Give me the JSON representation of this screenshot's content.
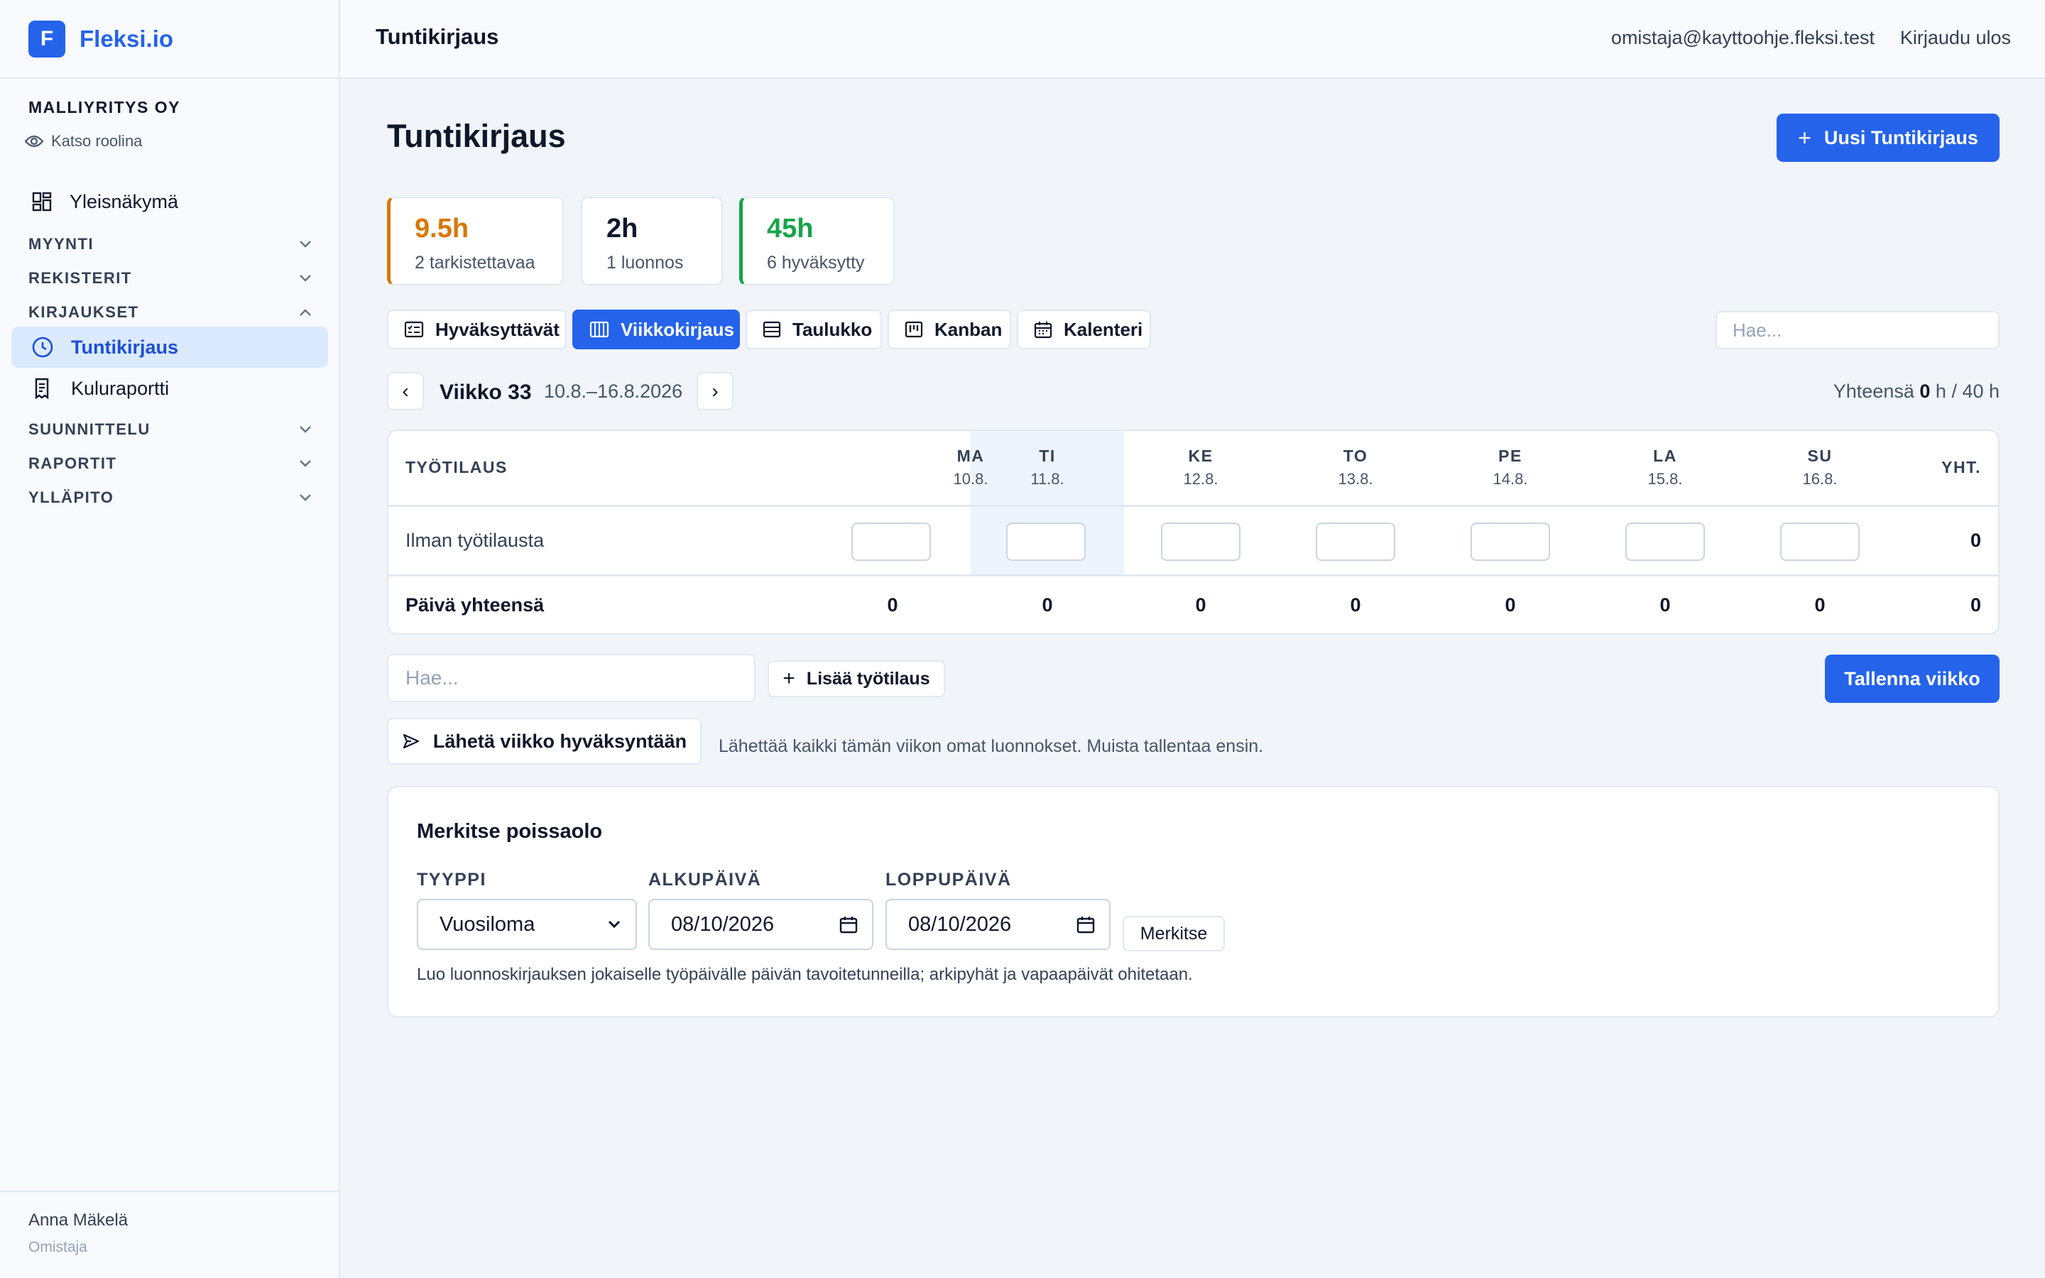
{
  "brand": {
    "logo_letter": "F",
    "name": "Fleksi.io"
  },
  "sidebar": {
    "company": "MALLIYRITYS OY",
    "view_as_role": "Katso roolina",
    "overview": "Yleisnäkymä",
    "sections": {
      "sales": "MYYNTI",
      "registers": "REKISTERIT",
      "entries": "KIRJAUKSET",
      "planning": "SUUNNITTELU",
      "reports": "RAPORTIT",
      "admin": "YLLÄPITO"
    },
    "entries_items": [
      {
        "label": "Tuntikirjaus",
        "icon": "clock-icon",
        "active": true
      },
      {
        "label": "Kuluraportti",
        "icon": "receipt-icon",
        "active": false
      }
    ],
    "user": {
      "name": "Anna Mäkelä",
      "role": "Omistaja"
    }
  },
  "topbar": {
    "title": "Tuntikirjaus",
    "email": "omistaja@kayttoohje.fleksi.test",
    "logout": "Kirjaudu ulos"
  },
  "main": {
    "title": "Tuntikirjaus",
    "new_entry_button": "Uusi Tuntikirjaus",
    "stats": [
      {
        "value": "9.5h",
        "label": "2 tarkistettavaa",
        "color": "#d97706"
      },
      {
        "value": "2h",
        "label": "1 luonnos",
        "color": "#0f172a"
      },
      {
        "value": "45h",
        "label": "6 hyväksytty",
        "color": "#16a34a"
      }
    ],
    "view_tabs": [
      {
        "label": "Hyväksyttävät",
        "icon": "approval-list-icon"
      },
      {
        "label": "Viikkokirjaus",
        "icon": "week-columns-icon",
        "active": true
      },
      {
        "label": "Taulukko",
        "icon": "table-icon"
      },
      {
        "label": "Kanban",
        "icon": "kanban-icon"
      },
      {
        "label": "Kalenteri",
        "icon": "calendar-icon"
      }
    ],
    "search_placeholder": "Hae...",
    "week": {
      "prev": "‹",
      "next": "›",
      "label": "Viikko 33",
      "range": "10.8.–16.8.2026",
      "total_prefix": "Yhteensä",
      "total_value": "0",
      "total_suffix": "h / 40 h"
    },
    "grid": {
      "order_header": "TYÖTILAUS",
      "total_header": "YHT.",
      "days": [
        {
          "name": "MA",
          "date": "10.8."
        },
        {
          "name": "TI",
          "date": "11.8.",
          "today": true
        },
        {
          "name": "KE",
          "date": "12.8."
        },
        {
          "name": "TO",
          "date": "13.8."
        },
        {
          "name": "PE",
          "date": "14.8."
        },
        {
          "name": "LA",
          "date": "15.8."
        },
        {
          "name": "SU",
          "date": "16.8."
        }
      ],
      "rows": [
        {
          "label": "Ilman työtilausta",
          "values": [
            "",
            "",
            "",
            "",
            "",
            "",
            ""
          ],
          "total": "0"
        }
      ],
      "footer": {
        "label": "Päivä yhteensä",
        "values": [
          "0",
          "0",
          "0",
          "0",
          "0",
          "0",
          "0"
        ],
        "total": "0"
      }
    },
    "order_search_placeholder": "Hae...",
    "add_order_button": "Lisää työtilaus",
    "save_week_button": "Tallenna viikko",
    "send_week_button": "Lähetä viikko hyväksyntään",
    "send_hint": "Lähettää kaikki tämän viikon omat luonnokset. Muista tallentaa ensin."
  },
  "absence": {
    "title": "Merkitse poissaolo",
    "type_label": "TYYPPI",
    "type_value": "Vuosiloma",
    "start_label": "ALKUPÄIVÄ",
    "start_value": "08/10/2026",
    "end_label": "LOPPUPÄIVÄ",
    "end_value": "08/10/2026",
    "submit": "Merkitse",
    "hint": "Luo luonnoskirjauksen jokaiselle työpäivälle päivän tavoitetunneilla; arkipyhät ja vapaapäivät ohitetaan."
  },
  "colors": {
    "accent": "#2563eb",
    "accent_light": "#dbeafe",
    "warning": "#d97706",
    "success": "#16a34a"
  }
}
